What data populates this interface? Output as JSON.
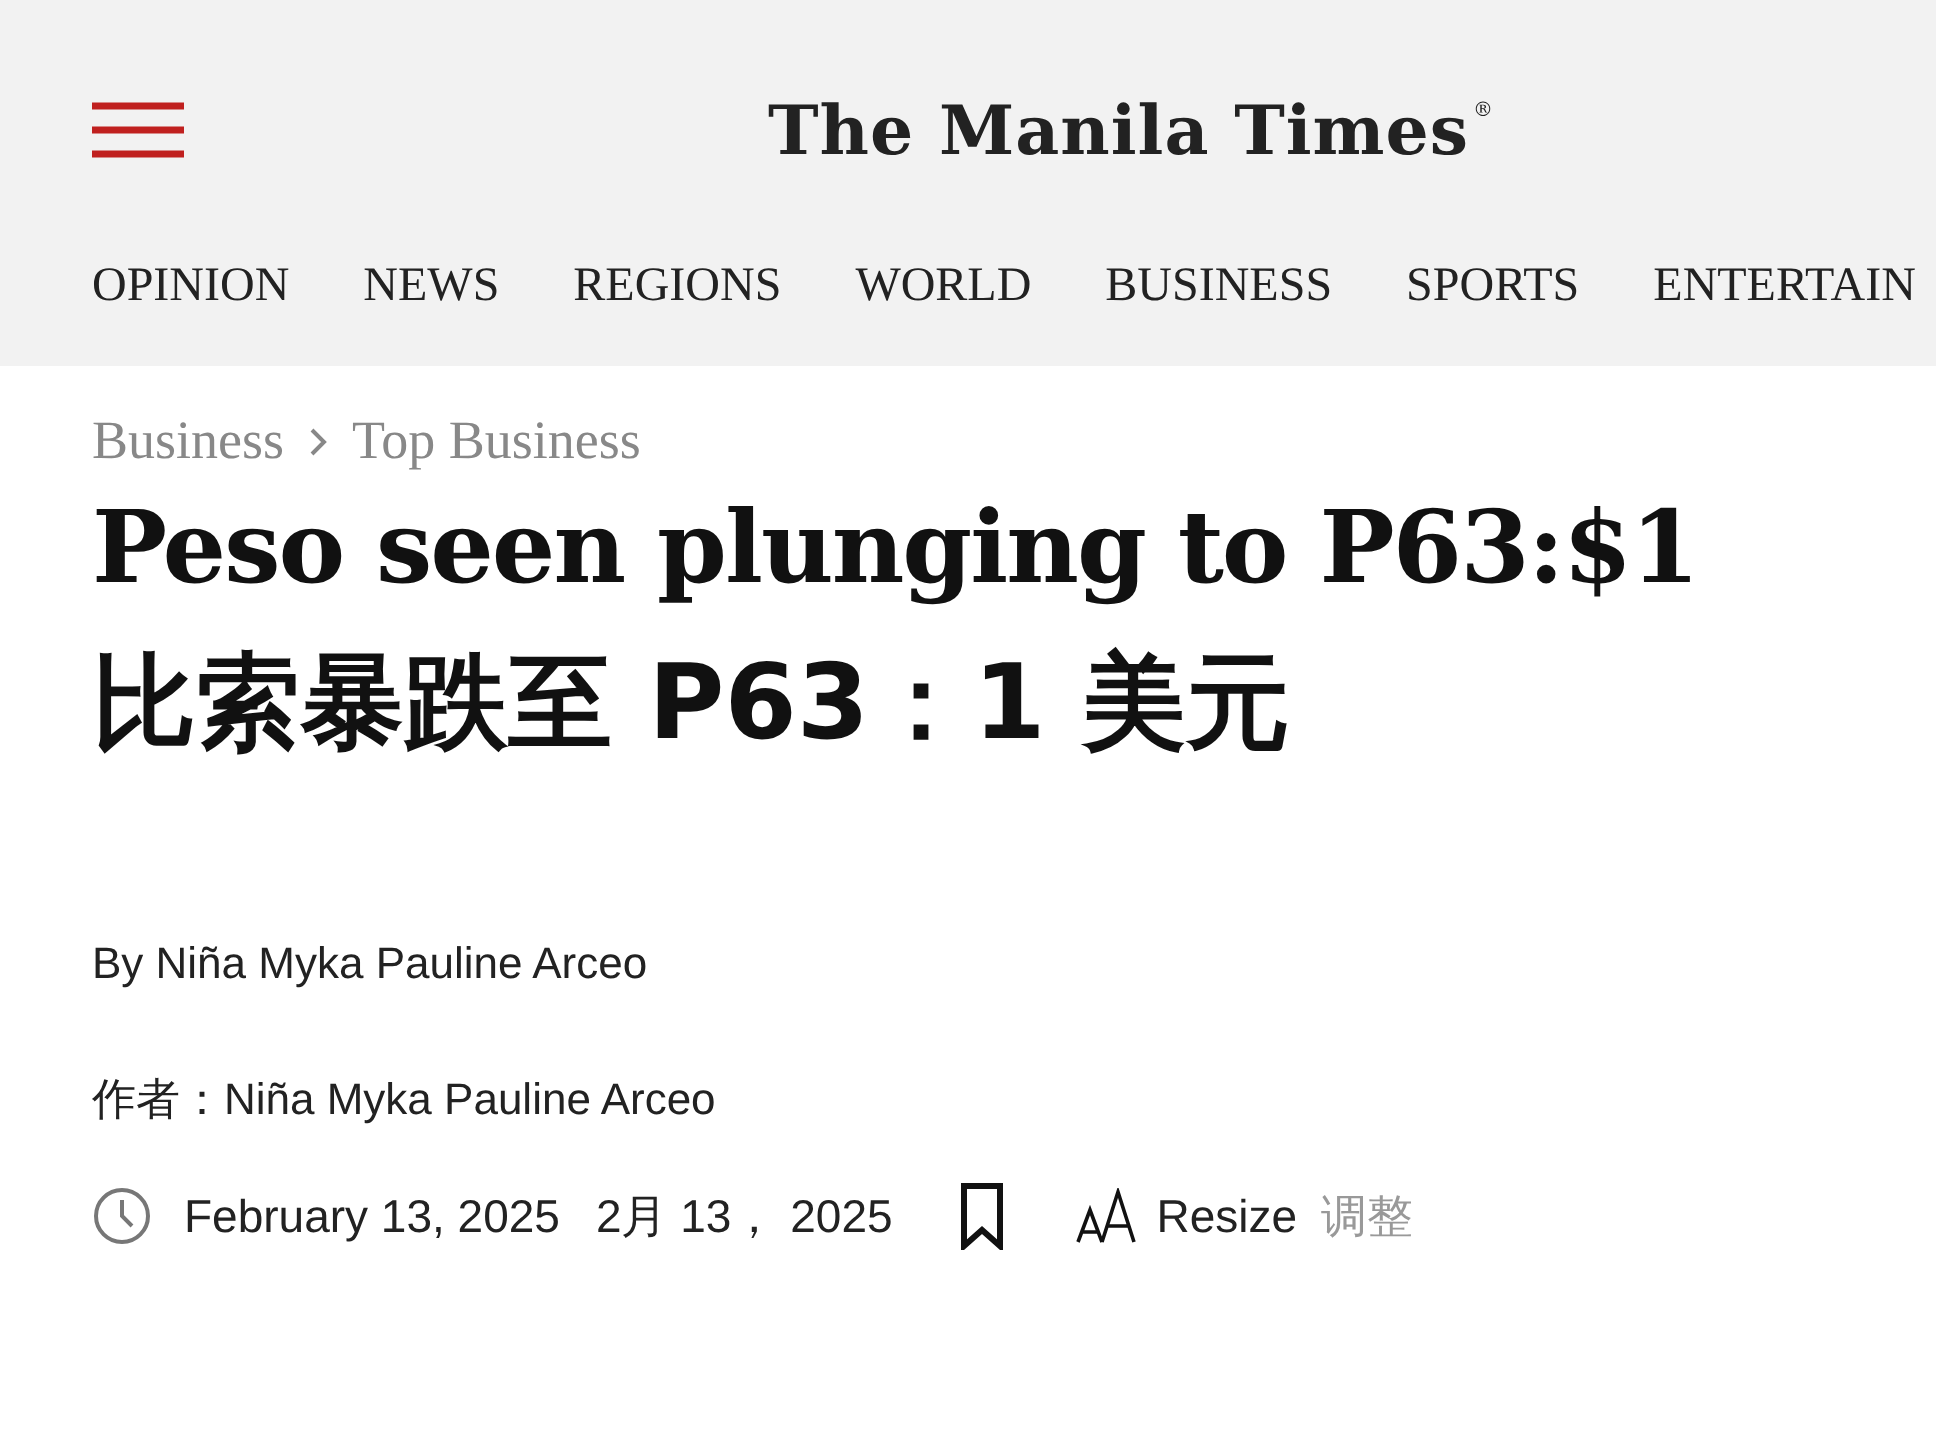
{
  "header": {
    "logo": "The Manila Times",
    "logo_mark": "®"
  },
  "nav": [
    "OPINION",
    "NEWS",
    "REGIONS",
    "WORLD",
    "BUSINESS",
    "SPORTS",
    "ENTERTAIN"
  ],
  "breadcrumb": [
    "Business",
    "Top Business"
  ],
  "headline": "Peso seen plunging to P63:$1",
  "headline_translation": "比索暴跌至 P63：1 美元",
  "byline": "By Niña Myka Pauline Arceo",
  "byline_translation": "作者：Niña Myka Pauline Arceo",
  "meta": {
    "date": "February 13, 2025",
    "date_translation": "2月 13， 2025",
    "resize": "Resize",
    "resize_translation": "调整"
  }
}
